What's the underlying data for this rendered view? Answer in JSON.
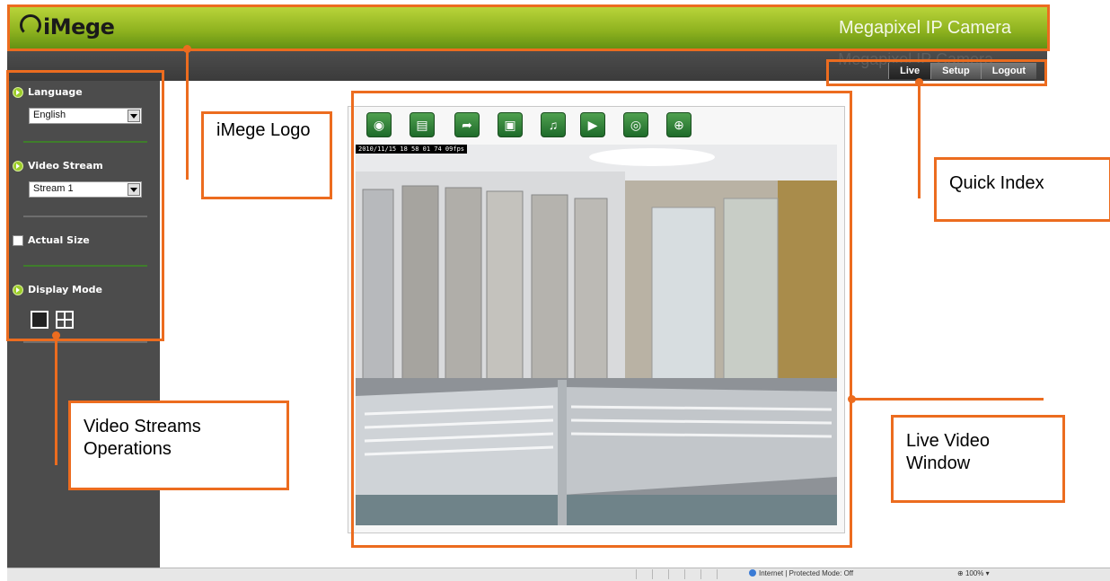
{
  "header": {
    "logo_text": "iMege",
    "product_name": "Megapixel IP Camera",
    "ghost_text": "Megapixel IP Camera",
    "brand_color": "#8eb21f"
  },
  "quick_index": {
    "items": [
      {
        "label": "Live",
        "active": true
      },
      {
        "label": "Setup",
        "active": false
      },
      {
        "label": "Logout",
        "active": false
      }
    ]
  },
  "sidebar": {
    "language": {
      "label": "Language",
      "value": "English"
    },
    "video_stream": {
      "label": "Video Stream",
      "value": "Stream 1"
    },
    "actual_size": {
      "label": "Actual Size",
      "checked": false
    },
    "display_mode": {
      "label": "Display Mode",
      "selected": "single"
    }
  },
  "video": {
    "osd_timestamp": "2010/11/15 18 58 01 74 09fps",
    "toolbar_icons": [
      "snapshot-icon",
      "record-icon",
      "folder-icon",
      "fullscreen-icon",
      "alarm-icon",
      "speaker-icon",
      "microphone-icon",
      "zoom-icon"
    ]
  },
  "annotations": {
    "logo": "iMege Logo",
    "quick_index": "Quick Index",
    "video_streams": "Video Streams Operations",
    "live_video": "Live Video Window",
    "color": "#ec6c1f"
  },
  "statusbar": {
    "zone_text": "Internet | Protected Mode: Off",
    "zoom_text": "100%"
  }
}
